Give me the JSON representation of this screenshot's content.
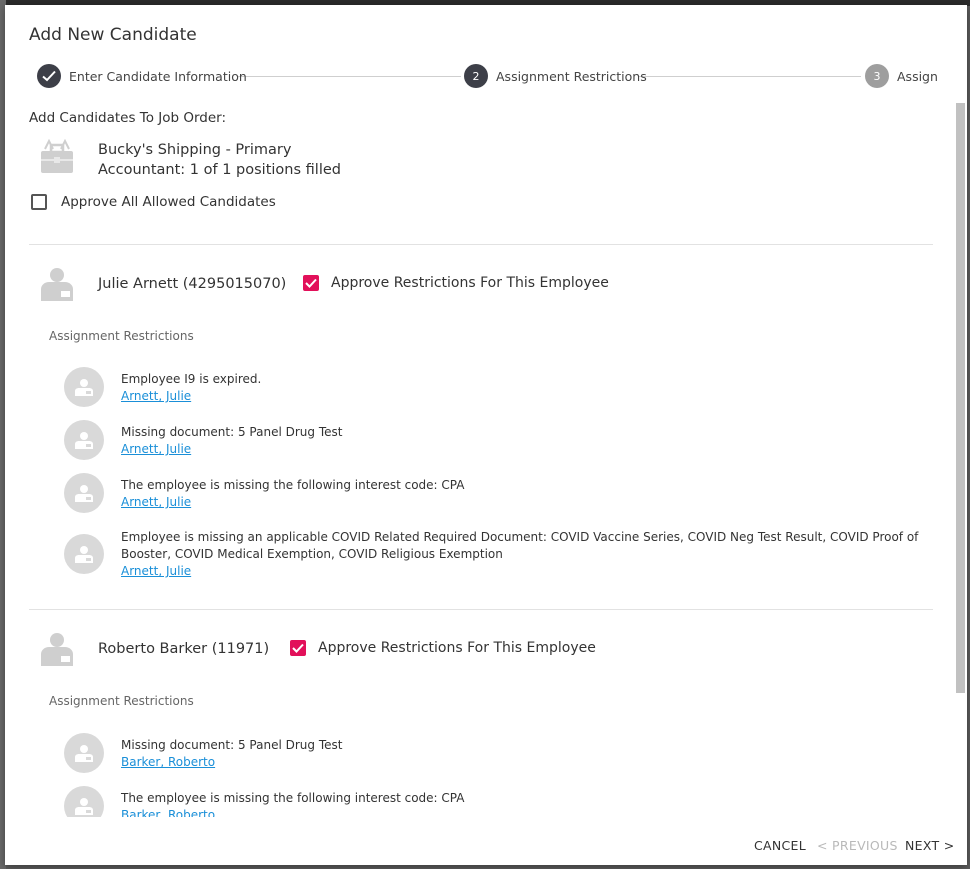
{
  "dialog": {
    "title": "Add New Candidate",
    "steps": [
      {
        "number": "",
        "label": "Enter Candidate Information",
        "state": "complete"
      },
      {
        "number": "2",
        "label": "Assignment Restrictions",
        "state": "active"
      },
      {
        "number": "3",
        "label": "Assign",
        "state": "pending"
      }
    ],
    "job_section": {
      "heading": "Add Candidates To Job Order:",
      "job_title": "Bucky's Shipping - Primary",
      "job_subtitle": "Accountant: 1 of 1 positions filled",
      "approve_all_label": "Approve All Allowed Candidates",
      "approve_all_checked": false
    },
    "employees": [
      {
        "name": "Julie Arnett (4295015070)",
        "approve_label": "Approve Restrictions For This Employee",
        "approved": true,
        "restrictions_heading": "Assignment Restrictions",
        "restrictions": [
          {
            "text": "Employee I9 is expired.",
            "link": "Arnett, Julie"
          },
          {
            "text": "Missing document: 5 Panel Drug Test",
            "link": "Arnett, Julie"
          },
          {
            "text": "The employee is missing the following interest code: CPA",
            "link": "Arnett, Julie"
          },
          {
            "text": "Employee is missing an applicable COVID Related Required Document: COVID Vaccine Series, COVID Neg Test Result, COVID Proof of Booster, COVID Medical Exemption, COVID Religious Exemption",
            "link": "Arnett, Julie"
          }
        ]
      },
      {
        "name": "Roberto Barker (11971)",
        "approve_label": "Approve Restrictions For This Employee",
        "approved": true,
        "restrictions_heading": "Assignment Restrictions",
        "restrictions": [
          {
            "text": "Missing document: 5 Panel Drug Test",
            "link": "Barker, Roberto"
          },
          {
            "text": "The employee is missing the following interest code: CPA",
            "link": "Barker, Roberto"
          }
        ]
      }
    ],
    "footer": {
      "cancel_label": "CANCEL",
      "previous_label": "< PREVIOUS",
      "next_label": "NEXT >"
    }
  },
  "colors": {
    "accent": "#e2105a",
    "step_active": "#3d3f48",
    "step_pending": "#9e9e9e",
    "link": "#1a8fd8"
  },
  "icons": {
    "step_complete": "check-icon",
    "job": "briefcase-icon",
    "employee": "person-badge-icon"
  }
}
